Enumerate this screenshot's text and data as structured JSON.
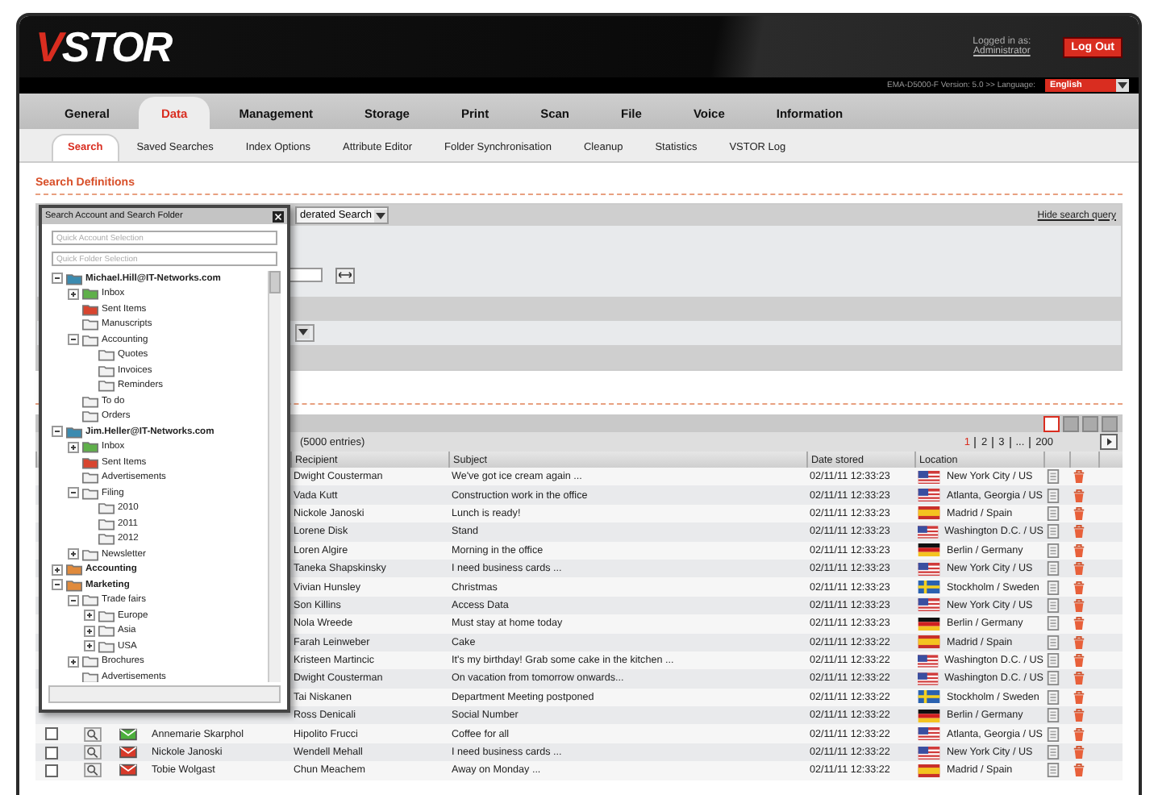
{
  "header": {
    "logo": "VSTOR",
    "logged_in_label": "Logged in as:",
    "user": "Administrator",
    "logout": "Log Out"
  },
  "version_bar": {
    "text": "EMA-D5000-F Version: 5.0 >> Language:",
    "language": "English"
  },
  "main_tabs": [
    {
      "label": "General",
      "selected": false
    },
    {
      "label": "Data",
      "selected": true
    },
    {
      "label": "Management",
      "selected": false
    },
    {
      "label": "Storage",
      "selected": false
    },
    {
      "label": "Print",
      "selected": false
    },
    {
      "label": "Scan",
      "selected": false
    },
    {
      "label": "File",
      "selected": false
    },
    {
      "label": "Voice",
      "selected": false
    },
    {
      "label": "Information",
      "selected": false
    }
  ],
  "sub_tabs": [
    {
      "label": "Search",
      "selected": true
    },
    {
      "label": "Saved Searches",
      "selected": false
    },
    {
      "label": "Index Options",
      "selected": false
    },
    {
      "label": "Attribute Editor",
      "selected": false
    },
    {
      "label": "Folder Synchronisation",
      "selected": false
    },
    {
      "label": "Cleanup",
      "selected": false
    },
    {
      "label": "Statistics",
      "selected": false
    },
    {
      "label": "VSTOR Log",
      "selected": false
    }
  ],
  "search_definitions": {
    "title": "Search Definitions",
    "search_type": "derated Search",
    "hide_link": "Hide search query"
  },
  "results": {
    "entries": "(5000 entries)",
    "pages": [
      {
        "label": "1",
        "selected": true
      },
      {
        "label": "2",
        "selected": false
      },
      {
        "label": "3",
        "selected": false
      },
      {
        "label": "...",
        "selected": false
      },
      {
        "label": "200",
        "selected": false
      }
    ],
    "columns": [
      "Recipient",
      "Subject",
      "Date stored",
      "Location"
    ],
    "rows": [
      {
        "recipient": "Dwight Cousterman",
        "subject": "We've got ice cream again ...",
        "date": "02/11/11 12:33:23",
        "flag": {
          "kind": "us"
        },
        "location": "New York City / US"
      },
      {
        "recipient": "Vada Kutt",
        "subject": "Construction work in the office",
        "date": "02/11/11 12:33:23",
        "flag": {
          "kind": "us"
        },
        "location": "Atlanta, Georgia / US"
      },
      {
        "recipient": "Nickole Janoski",
        "subject": "Lunch is ready!",
        "date": "02/11/11 12:33:23",
        "flag": {
          "kind": "es"
        },
        "location": "Madrid / Spain"
      },
      {
        "recipient": "Lorene Disk",
        "subject": "Stand",
        "date": "02/11/11 12:33:23",
        "flag": {
          "kind": "us"
        },
        "location": "Washington D.C. / US"
      },
      {
        "recipient": "Loren Algire",
        "subject": "Morning in the office",
        "date": "02/11/11 12:33:23",
        "flag": {
          "kind": "de"
        },
        "location": "Berlin / Germany"
      },
      {
        "recipient": "Taneka Shapskinsky",
        "subject": "I need business cards ...",
        "date": "02/11/11 12:33:23",
        "flag": {
          "kind": "us"
        },
        "location": "New York City / US"
      },
      {
        "recipient": "Vivian Hunsley",
        "subject": "Christmas",
        "date": "02/11/11 12:33:23",
        "flag": {
          "kind": "se"
        },
        "location": "Stockholm / Sweden"
      },
      {
        "recipient": "Son Killins",
        "subject": "Access Data",
        "date": "02/11/11 12:33:23",
        "flag": {
          "kind": "us"
        },
        "location": "New York City / US"
      },
      {
        "recipient": "Nola Wreede",
        "subject": "Must stay at home today",
        "date": "02/11/11 12:33:23",
        "flag": {
          "kind": "de"
        },
        "location": "Berlin / Germany"
      },
      {
        "recipient": "Farah Leinweber",
        "subject": "Cake",
        "date": "02/11/11 12:33:22",
        "flag": {
          "kind": "es"
        },
        "location": "Madrid / Spain"
      },
      {
        "recipient": "Kristeen Martincic",
        "subject": "It's my birthday! Grab some cake in the kitchen ...",
        "date": "02/11/11 12:33:22",
        "flag": {
          "kind": "us"
        },
        "location": "Washington D.C. / US"
      },
      {
        "recipient": "Dwight Cousterman",
        "subject": "On vacation from tomorrow onwards...",
        "date": "02/11/11 12:33:22",
        "flag": {
          "kind": "us"
        },
        "location": "Washington D.C. / US"
      },
      {
        "recipient": "Tai Niskanen",
        "subject": "Department Meeting postponed",
        "date": "02/11/11 12:33:22",
        "flag": {
          "kind": "se"
        },
        "location": "Stockholm / Sweden"
      },
      {
        "recipient": "Ross Denicali",
        "subject": "Social Number",
        "date": "02/11/11 12:33:22",
        "flag": {
          "kind": "de"
        },
        "location": "Berlin / Germany"
      },
      {
        "sender": "Annemarie Skarphol",
        "checked": false,
        "envelope": {
          "kind": "received"
        },
        "recipient": "Hipolito Frucci",
        "subject": "Coffee for all",
        "date": "02/11/11 12:33:22",
        "flag": {
          "kind": "us"
        },
        "location": "Atlanta, Georgia / US"
      },
      {
        "sender": "Nickole Janoski",
        "checked": false,
        "envelope": {
          "kind": "sent"
        },
        "recipient": "Wendell Mehall",
        "subject": "I need business cards ...",
        "date": "02/11/11 12:33:22",
        "flag": {
          "kind": "us"
        },
        "location": "New York City / US"
      },
      {
        "sender": "Tobie Wolgast",
        "checked": false,
        "envelope": {
          "kind": "sent"
        },
        "recipient": "Chun Meachem",
        "subject": "Away on Monday ...",
        "date": "02/11/11 12:33:22",
        "flag": {
          "kind": "es"
        },
        "location": "Madrid / Spain"
      }
    ]
  },
  "folder_popup": {
    "title": "Search Account and Search Folder",
    "account_placeholder": "Quick Account Selection",
    "folder_placeholder": "Quick Folder Selection",
    "tree": [
      {
        "label": "Michael.Hill@IT-Networks.com",
        "kind": "account",
        "expanded": true,
        "children": [
          {
            "label": "Inbox",
            "kind": "inbox",
            "expanded": false
          },
          {
            "label": "Sent Items",
            "kind": "sent"
          },
          {
            "label": "Manuscripts",
            "kind": "folder"
          },
          {
            "label": "Accounting",
            "kind": "folder",
            "expanded": true,
            "children": [
              {
                "label": "Quotes",
                "kind": "folder"
              },
              {
                "label": "Invoices",
                "kind": "folder"
              },
              {
                "label": "Reminders",
                "kind": "folder"
              }
            ]
          },
          {
            "label": "To do",
            "kind": "folder"
          },
          {
            "label": "Orders",
            "kind": "folder"
          }
        ]
      },
      {
        "label": "Jim.Heller@IT-Networks.com",
        "kind": "account",
        "expanded": true,
        "children": [
          {
            "label": "Inbox",
            "kind": "inbox",
            "expanded": false
          },
          {
            "label": "Sent Items",
            "kind": "sent"
          },
          {
            "label": "Advertisements",
            "kind": "folder"
          },
          {
            "label": "Filing",
            "kind": "folder",
            "expanded": true,
            "children": [
              {
                "label": "2010",
                "kind": "folder"
              },
              {
                "label": "2011",
                "kind": "folder"
              },
              {
                "label": "2012",
                "kind": "folder"
              }
            ]
          },
          {
            "label": "Newsletter",
            "kind": "folder",
            "expanded": false
          }
        ]
      },
      {
        "label": "Accounting",
        "kind": "public",
        "expanded": false
      },
      {
        "label": "Marketing",
        "kind": "public",
        "expanded": true,
        "children": [
          {
            "label": "Trade fairs",
            "kind": "folder",
            "expanded": true,
            "children": [
              {
                "label": "Europe",
                "kind": "folder",
                "expanded": false
              },
              {
                "label": "Asia",
                "kind": "folder",
                "expanded": false
              },
              {
                "label": "USA",
                "kind": "folder",
                "expanded": false
              }
            ]
          },
          {
            "label": "Brochures",
            "kind": "folder",
            "expanded": false
          },
          {
            "label": "Advertisements",
            "kind": "folder"
          }
        ]
      }
    ]
  }
}
